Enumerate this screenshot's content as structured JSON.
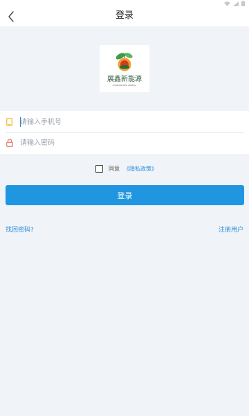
{
  "nav": {
    "title": "登录"
  },
  "logo": {
    "brand_text": "展鑫新能源",
    "sub_text": "ZHANXIN NEW ENERGY"
  },
  "form": {
    "phone_placeholder": "请输入手机号",
    "phone_value": "",
    "password_placeholder": "请输入密码",
    "password_value": ""
  },
  "agreement": {
    "checked": false,
    "prefix": "同意",
    "policy_link": "《隐私政策》"
  },
  "actions": {
    "login_label": "登录",
    "forgot_label": "找回密码?",
    "register_label": "注册用户"
  },
  "colors": {
    "accent": "#2196e0",
    "link": "#2a8ad8",
    "background": "#f0f4f8",
    "phone_icon": "#f5b83a",
    "lock_icon": "#e8796a"
  },
  "icons": {
    "status": [
      "wifi-icon",
      "signal-icon",
      "battery-icon"
    ],
    "back": "chevron-left-icon",
    "phone": "phone-icon",
    "lock": "lock-icon"
  }
}
